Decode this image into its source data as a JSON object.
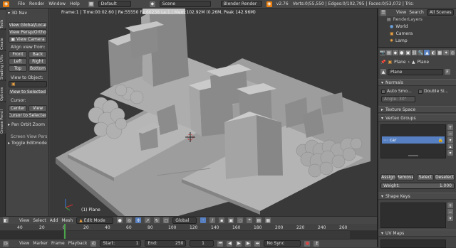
{
  "menu": {
    "file": "File",
    "render": "Render",
    "window": "Window",
    "help": "Help",
    "layout": "Default",
    "scene": "Scene",
    "engine": "Blender Render",
    "version": "v2.76",
    "stats": "Verts:0/55,550 | Edges:0/102,795 | Faces:0/53,072 | Tris:102,930 | Objects:1"
  },
  "viewport": {
    "info": "Frame:1 | Time:00:02.60 | Re:55550 Fa:60238 La:1 | Mem:102.92M (0.26M, Peak 142.96M)",
    "object_label": "(1) Plane"
  },
  "toolshelf": {
    "tabs": [
      "Tools",
      "Create",
      "Shading / UVs",
      "Options",
      "Grease Pencil"
    ],
    "nav_header": "3D Nav",
    "view_global": "View Global/Local",
    "view_persp": "View Persp/Ortho",
    "view_camera": "View Camera",
    "align_label": "Align view from:",
    "front": "Front",
    "back": "Back",
    "left": "Left",
    "right": "Right",
    "top": "Top",
    "bottom": "Bottom",
    "view_to_object": "View to Object:",
    "view_selected": "View to Selected",
    "cursor_label": "Cursor:",
    "center": "Center",
    "view": "View",
    "cursor_to_selected": "Cursor to Selected",
    "pan_orbit": "Pan Orbit Zoom",
    "screen_view": "Screen View Pers",
    "toggle_editmode": "Toggle Editmode"
  },
  "view_header": {
    "view": "View",
    "select": "Select",
    "add": "Add",
    "mesh": "Mesh",
    "mode": "Edit Mode",
    "orientation": "Global"
  },
  "outliner": {
    "view": "View",
    "search": "Search",
    "filter": "All Scenes",
    "items": [
      "RenderLayers",
      "World",
      "Camera",
      "Lamp"
    ]
  },
  "properties": {
    "object_name": "Plane",
    "breadcrumb_object": "Plane",
    "mesh_name": "Plane",
    "normals": "Normals",
    "auto_smooth": "Auto Smo...",
    "double_sided": "Double Si...",
    "angle": "Angle:   30°",
    "texture_space": "Texture Space",
    "vertex_groups": "Vertex Groups",
    "group_item": "car",
    "assign": "Assign",
    "remove": "Remove",
    "select": "Select",
    "deselect": "Deselect",
    "weight_label": "Weight:",
    "weight_value": "1.000",
    "shape_keys": "Shape Keys",
    "uv_maps": "UV Maps"
  },
  "timeline": {
    "ticks": [
      "40",
      "20",
      "0",
      "20",
      "40",
      "60",
      "80",
      "100",
      "120",
      "140",
      "160",
      "180",
      "200",
      "220",
      "240",
      "260"
    ],
    "view": "View",
    "marker": "Marker",
    "frame": "Frame",
    "playback": "Playback",
    "start_label": "Start:",
    "start_value": "1",
    "end_label": "End:",
    "end_value": "250",
    "current": "1",
    "sync": "No Sync"
  },
  "colors": {
    "accent": "#5680c2",
    "background": "#3d3d3d",
    "viewport": "#393939",
    "ground": "#9c9c9c"
  }
}
